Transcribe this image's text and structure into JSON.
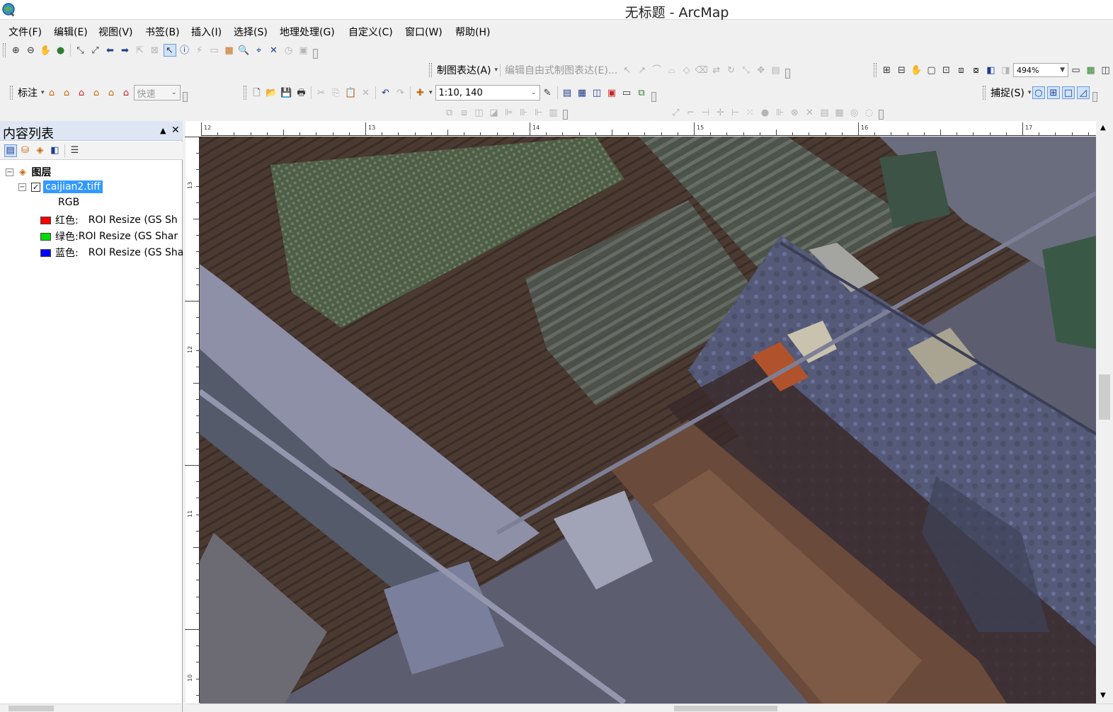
{
  "window": {
    "title": "无标题 - ArcMap"
  },
  "menubar": {
    "items": [
      "文件(F)",
      "编辑(E)",
      "视图(V)",
      "书签(B)",
      "插入(I)",
      "选择(S)",
      "地理处理(G)",
      "自定义(C)",
      "窗口(W)",
      "帮助(H)"
    ]
  },
  "toolbars": {
    "representation_label": "制图表达(A)",
    "free_representation_label": "编辑自由式制图表达(E)...",
    "zoom_level": "494%",
    "label_menu": "标注",
    "label_speed": "快速",
    "map_scale": "1:10, 140",
    "snapping_label": "捕捉(S)"
  },
  "toc": {
    "title": "内容列表",
    "pin": "▲",
    "close": "✕",
    "root": {
      "label": "图层",
      "expander": "−"
    },
    "layer": {
      "label": "caijian2.tiff",
      "expander": "−",
      "checked": "✓",
      "subtitle": "RGB"
    },
    "bands": [
      {
        "channel": "红色:",
        "source": "ROI Resize (GS Sh",
        "color": "#ff0000"
      },
      {
        "channel": "绿色:",
        "source": "ROI Resize (GS Shar",
        "color": "#00dd00"
      },
      {
        "channel": "蓝色:",
        "source": "ROI Resize (GS Sha",
        "color": "#0000ff"
      }
    ]
  },
  "ruler": {
    "h_labels": [
      "12",
      "13",
      "14",
      "15",
      "16",
      "17"
    ],
    "v_labels": [
      "13",
      "12",
      "11",
      "10"
    ]
  },
  "colors": {
    "selection": "#3399ff",
    "toc_header": "#dde6f2",
    "map_background": "#6b6e7a"
  },
  "icons": [
    "app-globe-icon",
    "zoom-in-icon",
    "zoom-out-icon",
    "pan-icon",
    "full-extent-icon",
    "select-elements-icon",
    "identify-icon",
    "add-data-icon",
    "save-icon",
    "print-icon",
    "undo-icon",
    "redo-icon",
    "snap-point-icon",
    "snap-end-icon",
    "snap-vertex-icon",
    "snap-edge-icon"
  ]
}
